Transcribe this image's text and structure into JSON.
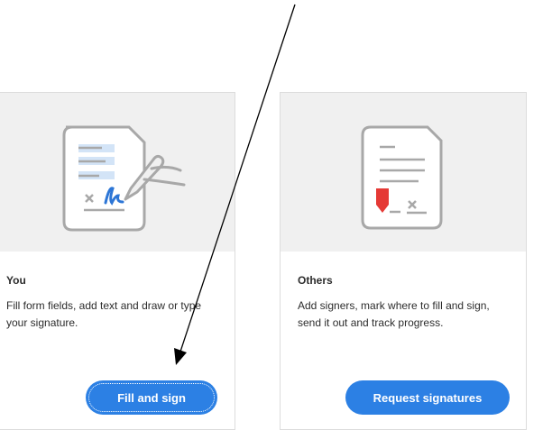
{
  "cards": {
    "you": {
      "title": "You",
      "description": "Fill form fields, add text and draw or type your signature.",
      "button_label": "Fill and sign",
      "icon": "document-sign-icon"
    },
    "others": {
      "title": "Others",
      "description": "Add signers, mark where to fill and sign, send it out and track progress.",
      "button_label": "Request signatures",
      "icon": "document-request-icon"
    }
  },
  "colors": {
    "accent": "#2c80e4",
    "illustration_bg": "#f0f0f0",
    "signature_blue": "#2d76d6",
    "marker_red": "#e53935"
  },
  "annotation": {
    "icon": "arrow-annotation-icon"
  }
}
